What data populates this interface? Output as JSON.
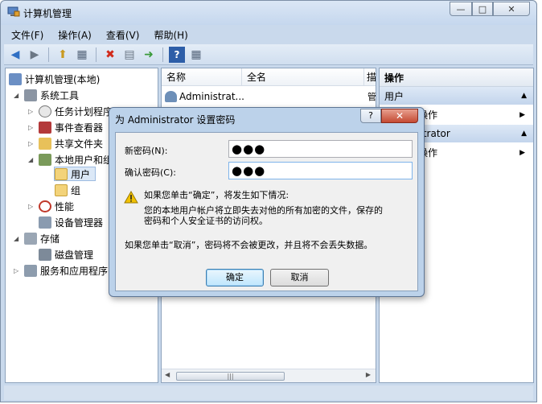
{
  "window": {
    "title": "计算机管理"
  },
  "menu": [
    "文件(F)",
    "操作(A)",
    "查看(V)",
    "帮助(H)"
  ],
  "tree": [
    {
      "label": "计算机管理(本地)",
      "level": 0,
      "expander": ""
    },
    {
      "label": "系统工具",
      "level": 1,
      "expander": "◢"
    },
    {
      "label": "任务计划程序",
      "level": 2,
      "expander": "▷"
    },
    {
      "label": "事件查看器",
      "level": 2,
      "expander": "▷"
    },
    {
      "label": "共享文件夹",
      "level": 2,
      "expander": "▷"
    },
    {
      "label": "本地用户和组",
      "level": 2,
      "expander": "◢"
    },
    {
      "label": "用户",
      "level": 3,
      "expander": ""
    },
    {
      "label": "组",
      "level": 3,
      "expander": ""
    },
    {
      "label": "性能",
      "level": 2,
      "expander": "▷"
    },
    {
      "label": "设备管理器",
      "level": 2,
      "expander": ""
    },
    {
      "label": "存储",
      "level": 1,
      "expander": "◢"
    },
    {
      "label": "磁盘管理",
      "level": 2,
      "expander": ""
    },
    {
      "label": "服务和应用程序",
      "level": 1,
      "expander": "▷"
    }
  ],
  "list": {
    "columns": [
      "名称",
      "全名",
      "描"
    ],
    "rows": [
      {
        "name": "Administrat...",
        "desc": "管"
      }
    ]
  },
  "actions": {
    "header": "操作",
    "sections": [
      {
        "title": "用户",
        "item": "更多操作"
      },
      {
        "title": "Administrator",
        "item": "更多操作"
      }
    ]
  },
  "dialog": {
    "title": "为 Administrator 设置密码",
    "help_glyph": "?",
    "close_glyph": "✕",
    "new_password_label": "新密码(N):",
    "new_password_value": "●●●",
    "confirm_password_label": "确认密码(C):",
    "confirm_password_value": "●●●",
    "warning_heading": "如果您单击“确定”，将发生如下情况:",
    "warning_line1": "您的本地用户帐户将立即失去对他的所有加密的文件，保存的",
    "warning_line2": "密码和个人安全证书的访问权。",
    "cancel_note": "如果您单击“取消”，密码将不会被更改，并且将不会丢失数据。",
    "ok_label": "确定",
    "cancel_label": "取消"
  },
  "colors": {
    "accent": "#3c7fb1",
    "close_red": "#c44a33",
    "warning_yellow": "#f2c200"
  }
}
